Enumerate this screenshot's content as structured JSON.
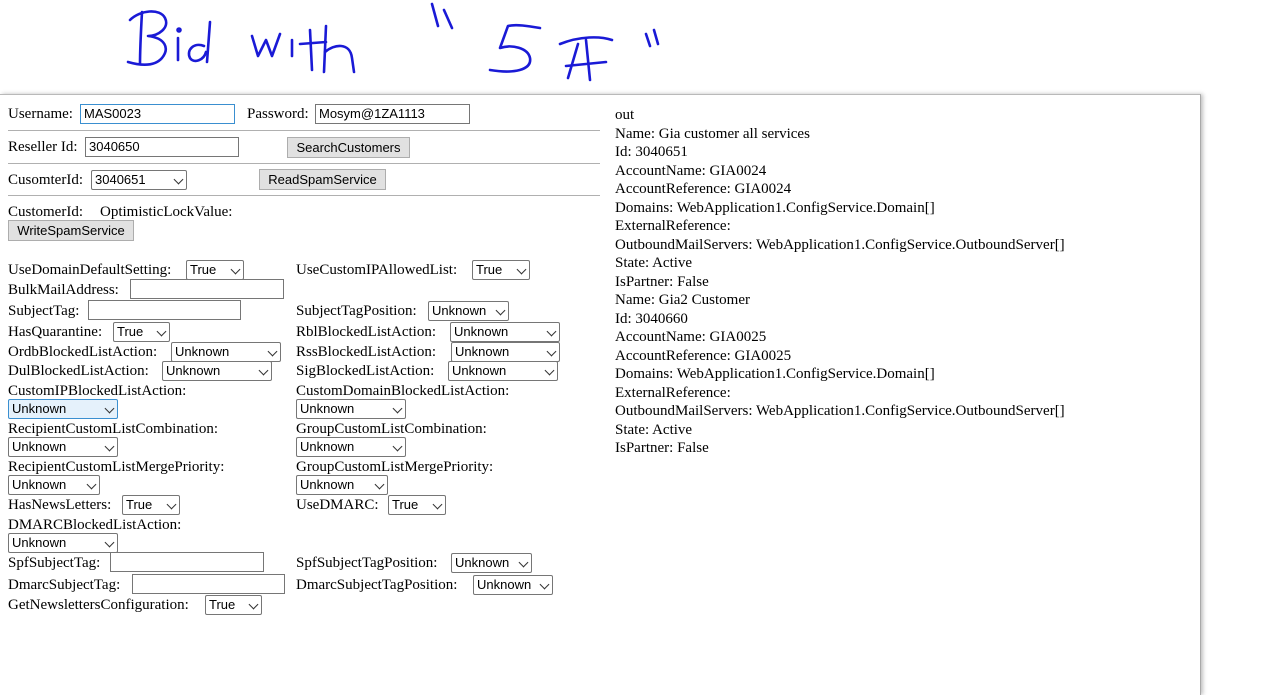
{
  "annotation": {
    "text": "Bid with \"5A\"",
    "ink_color": "#1a1ad6"
  },
  "login": {
    "username_label": "Username:",
    "username_value": "MAS0023",
    "password_label": "Password:",
    "password_value": "Mosym@1ZA1113"
  },
  "reseller": {
    "label": "Reseller Id:",
    "value": "3040650",
    "search_button": "SearchCustomers"
  },
  "customer": {
    "label": "CusomterId:",
    "selected": "3040651",
    "read_button": "ReadSpamService"
  },
  "write": {
    "customer_id_label": "CustomerId:",
    "lock_label": "OptimisticLockValue:",
    "write_button": "WriteSpamService"
  },
  "fields": {
    "use_domain_default_setting": {
      "label": "UseDomainDefaultSetting:",
      "value": "True"
    },
    "use_custom_ip_allowed_list": {
      "label": "UseCustomIPAllowedList:",
      "value": "True"
    },
    "bulk_mail_address": {
      "label": "BulkMailAddress:",
      "value": ""
    },
    "subject_tag": {
      "label": "SubjectTag:",
      "value": ""
    },
    "subject_tag_position": {
      "label": "SubjectTagPosition:",
      "value": "Unknown"
    },
    "has_quarantine": {
      "label": "HasQuarantine:",
      "value": "True"
    },
    "rbl_blocked_list_action": {
      "label": "RblBlockedListAction:",
      "value": "Unknown"
    },
    "ordb_blocked_list_action": {
      "label": "OrdbBlockedListAction:",
      "value": "Unknown"
    },
    "rss_blocked_list_action": {
      "label": "RssBlockedListAction:",
      "value": "Unknown"
    },
    "dul_blocked_list_action": {
      "label": "DulBlockedListAction:",
      "value": "Unknown"
    },
    "sig_blocked_list_action": {
      "label": "SigBlockedListAction:",
      "value": "Unknown"
    },
    "custom_ip_blocked_list_action": {
      "label": "CustomIPBlockedListAction:",
      "value": "Unknown"
    },
    "custom_domain_blocked_list_action": {
      "label": "CustomDomainBlockedListAction:",
      "value": "Unknown"
    },
    "recipient_custom_list_combination": {
      "label": "RecipientCustomListCombination:",
      "value": "Unknown"
    },
    "group_custom_list_combination": {
      "label": "GroupCustomListCombination:",
      "value": "Unknown"
    },
    "recipient_custom_list_merge_priority": {
      "label": "RecipientCustomListMergePriority:",
      "value": "Unknown"
    },
    "group_custom_list_merge_priority": {
      "label": "GroupCustomListMergePriority:",
      "value": "Unknown"
    },
    "has_news_letters": {
      "label": "HasNewsLetters:",
      "value": "True"
    },
    "use_dmarc": {
      "label": "UseDMARC:",
      "value": "True"
    },
    "dmarc_blocked_list_action": {
      "label": "DMARCBlockedListAction:",
      "value": "Unknown"
    },
    "spf_subject_tag": {
      "label": "SpfSubjectTag:",
      "value": ""
    },
    "spf_subject_tag_position": {
      "label": "SpfSubjectTagPosition:",
      "value": "Unknown"
    },
    "dmarc_subject_tag": {
      "label": "DmarcSubjectTag:",
      "value": ""
    },
    "dmarc_subject_tag_position": {
      "label": "DmarcSubjectTagPosition:",
      "value": "Unknown"
    },
    "get_newsletters_configuration": {
      "label": "GetNewslettersConfiguration:",
      "value": "True"
    }
  },
  "output": {
    "title": "out",
    "lines": [
      "Name: Gia customer all services",
      "Id: 3040651",
      "AccountName: GIA0024",
      "AccountReference: GIA0024",
      "Domains: WebApplication1.ConfigService.Domain[]",
      "ExternalReference:",
      "OutboundMailServers: WebApplication1.ConfigService.OutboundServer[]",
      "State: Active",
      "IsPartner: False",
      "Name: Gia2 Customer",
      "Id: 3040660",
      "AccountName: GIA0025",
      "AccountReference: GIA0025",
      "Domains: WebApplication1.ConfigService.Domain[]",
      "ExternalReference:",
      "OutboundMailServers: WebApplication1.ConfigService.OutboundServer[]",
      "State: Active",
      "IsPartner: False"
    ]
  }
}
